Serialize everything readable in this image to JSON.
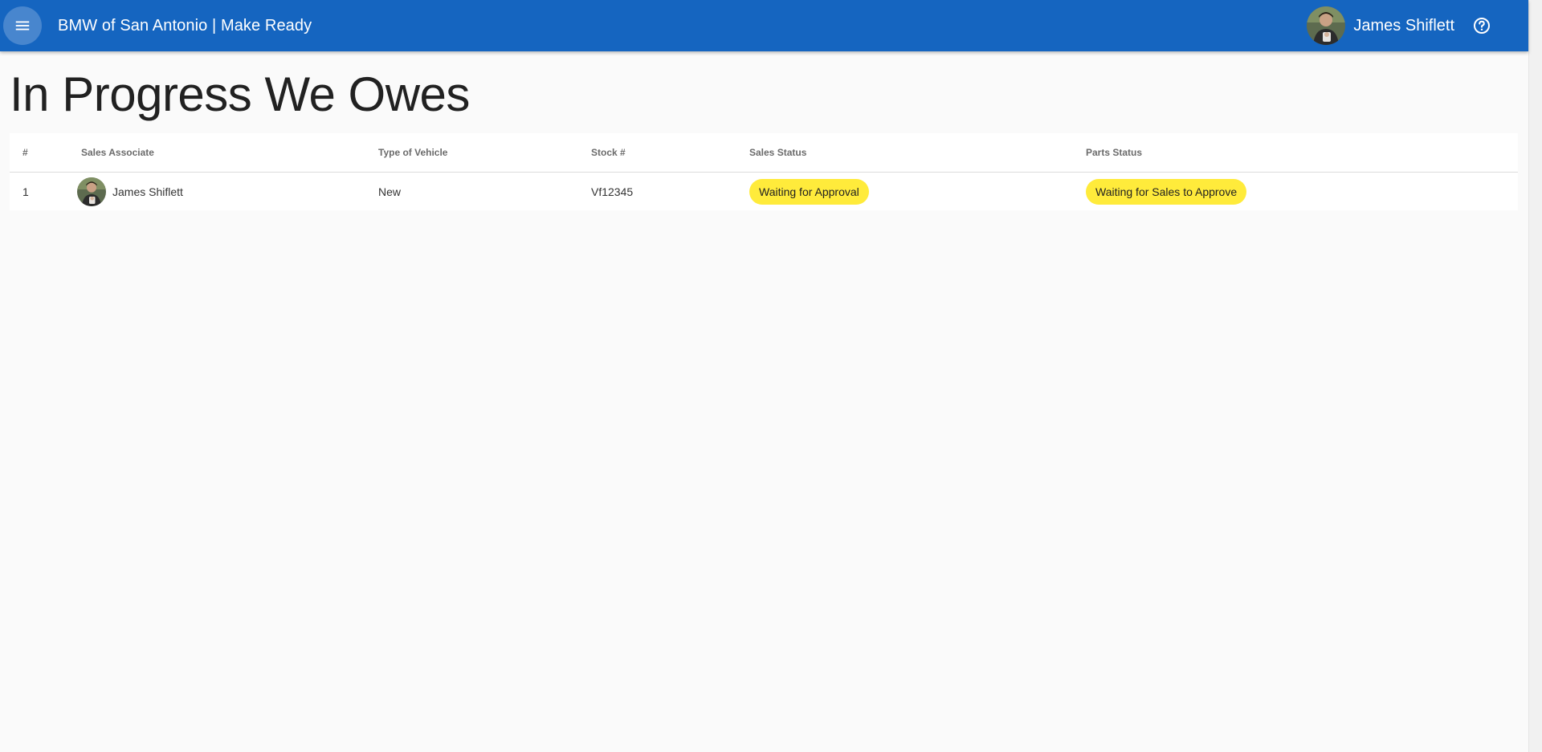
{
  "header": {
    "menu_icon": "hamburger-menu-icon",
    "title": "BMW of San Antonio | Make Ready",
    "user_name": "James Shiflett",
    "help_icon": "help-circle-icon",
    "bar_color": "#1565c0"
  },
  "page": {
    "title": "In Progress We Owes"
  },
  "table": {
    "columns": [
      "#",
      "Sales Associate",
      "Type of Vehicle",
      "Stock #",
      "Sales Status",
      "Parts Status"
    ],
    "rows": [
      {
        "num": "1",
        "associate": "James Shiflett",
        "vehicle_type": "New",
        "stock": "Vf12345",
        "sales_status": "Waiting for Approval",
        "parts_status": "Waiting for Sales to Approve"
      }
    ],
    "status_chip_color": "#ffeb3b"
  }
}
